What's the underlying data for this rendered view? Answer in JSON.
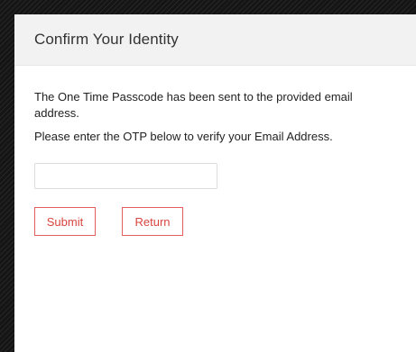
{
  "dialog": {
    "title": "Confirm Your Identity",
    "message_sent": "The One Time Passcode has been sent to the provided email address.",
    "message_instruction": "Please enter the OTP below to verify your Email Address.",
    "otp_input": {
      "value": "",
      "placeholder": ""
    },
    "submit_label": "Submit",
    "return_label": "Return"
  },
  "colors": {
    "accent": "#d9453f",
    "header_bg": "#f2f2f2",
    "background": "#1b1b1b"
  }
}
